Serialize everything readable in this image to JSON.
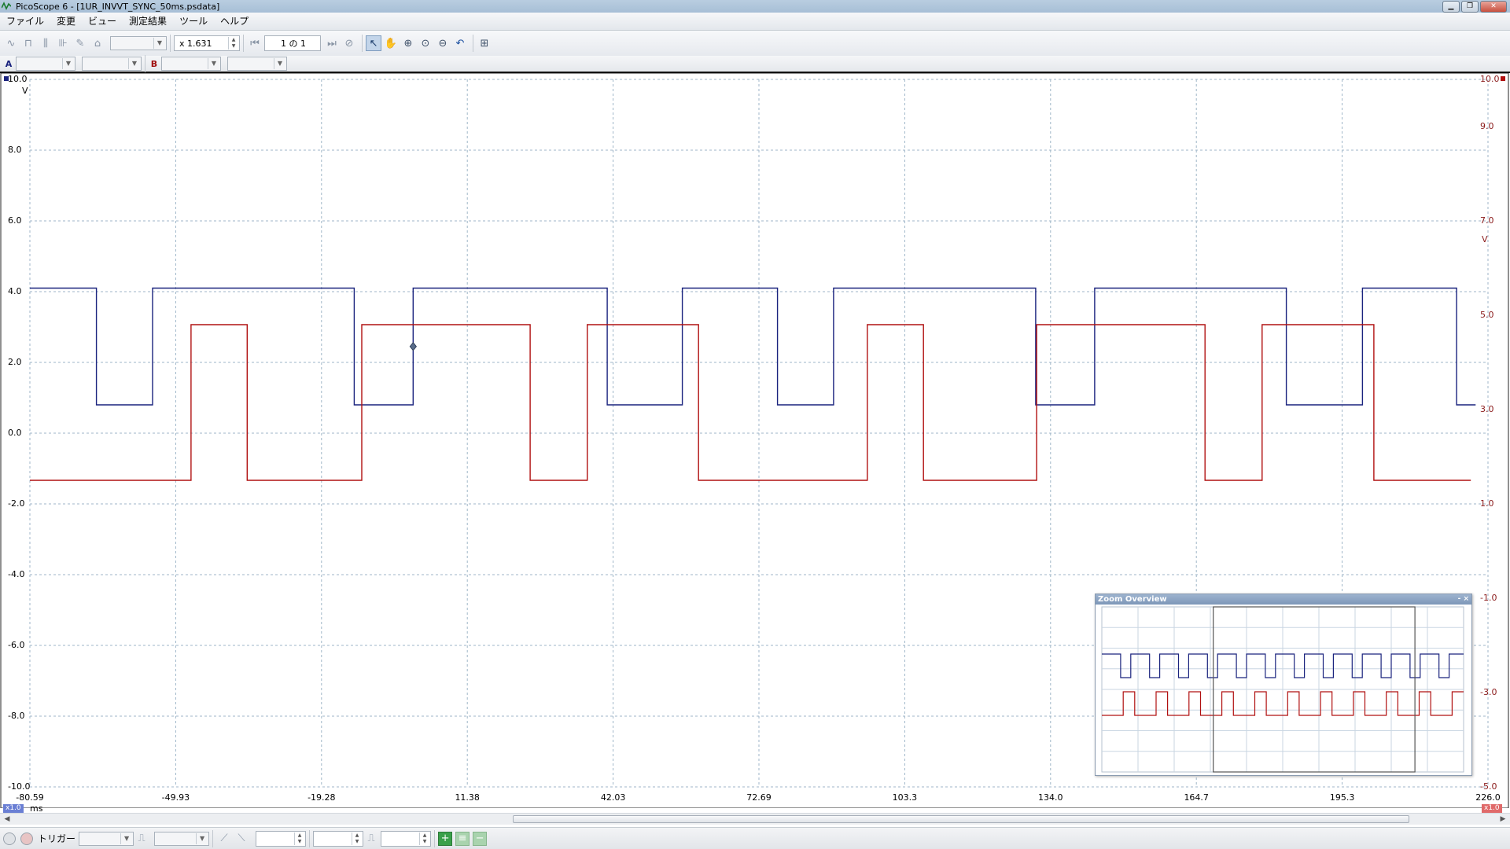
{
  "window": {
    "title": "PicoScope 6 - [1UR_INVVT_SYNC_50ms.psdata]"
  },
  "menu": [
    "ファイル",
    "変更",
    "ビュー",
    "測定結果",
    "ツール",
    "ヘルプ"
  ],
  "toolbar": {
    "zoom_value": "x 1.631",
    "page_value": "1 の 1"
  },
  "channels": {
    "a_label": "A",
    "b_label": "B"
  },
  "axes": {
    "left_ticks": [
      "10.0",
      "8.0",
      "6.0",
      "4.0",
      "2.0",
      "0.0",
      "-2.0",
      "-4.0",
      "-6.0",
      "-8.0",
      "-10.0"
    ],
    "left_unit": "V",
    "right_ticks": [
      "10.0",
      "9.0",
      "7.0",
      "5.0",
      "3.0",
      "1.0",
      "-1.0",
      "-3.0",
      "-5.0"
    ],
    "right_unit": "V",
    "x_ticks": [
      "-80.59",
      "-49.93",
      "-19.28",
      "11.38",
      "42.03",
      "72.69",
      "103.3",
      "134.0",
      "164.7",
      "195.3",
      "226.0"
    ],
    "x_unit": "ms",
    "left_scale_badge": "x1.0",
    "right_scale_badge": "x1.0"
  },
  "zoom_overview": {
    "title": "Zoom Overview",
    "controls": "- ×"
  },
  "statusbar": {
    "trigger_label": "トリガー"
  },
  "icons": [
    "channel-a-icon",
    "channel-b-icon",
    "pointer-icon",
    "hand-icon",
    "zoom-in-icon",
    "zoom-out-icon",
    "undo-zoom-icon"
  ],
  "chart_data": {
    "type": "line",
    "xlabel": "ms",
    "ylabel": "V",
    "xlim": [
      -80.59,
      226.0
    ],
    "ylim": [
      -10.0,
      10.0
    ],
    "right_ylim": [
      -5.0,
      10.0
    ],
    "grid": true,
    "series": [
      {
        "name": "A",
        "color": "#1a237e",
        "high": 4.1,
        "low": 0.8,
        "transitions_ms": [
          [
            -80.59,
            4.1
          ],
          [
            -66.6,
            4.1
          ],
          [
            -66.6,
            0.8
          ],
          [
            -54.8,
            0.8
          ],
          [
            -54.8,
            4.1
          ],
          [
            -12.4,
            4.1
          ],
          [
            -12.4,
            0.8
          ],
          [
            0.0,
            0.8
          ],
          [
            0.0,
            4.1
          ],
          [
            40.8,
            4.1
          ],
          [
            40.8,
            0.8
          ],
          [
            56.6,
            0.8
          ],
          [
            56.6,
            4.1
          ],
          [
            76.6,
            4.1
          ],
          [
            76.6,
            0.8
          ],
          [
            88.4,
            0.8
          ],
          [
            88.4,
            4.1
          ],
          [
            130.9,
            4.1
          ],
          [
            130.9,
            0.8
          ],
          [
            143.3,
            0.8
          ],
          [
            143.3,
            4.1
          ],
          [
            183.6,
            4.1
          ],
          [
            183.6,
            0.8
          ],
          [
            199.6,
            0.8
          ],
          [
            199.6,
            4.1
          ],
          [
            219.4,
            4.1
          ],
          [
            219.4,
            0.8
          ],
          [
            223.4,
            0.8
          ]
        ]
      },
      {
        "name": "B",
        "color": "#b01010",
        "high": 4.8,
        "low": 1.5,
        "transitions_ms": [
          [
            -80.59,
            1.5
          ],
          [
            -46.7,
            1.5
          ],
          [
            -46.7,
            4.8
          ],
          [
            -34.9,
            4.8
          ],
          [
            -34.9,
            1.5
          ],
          [
            -10.8,
            1.5
          ],
          [
            -10.8,
            4.8
          ],
          [
            24.6,
            4.8
          ],
          [
            24.6,
            1.5
          ],
          [
            36.6,
            1.5
          ],
          [
            36.6,
            4.8
          ],
          [
            60.0,
            4.8
          ],
          [
            60.0,
            1.5
          ],
          [
            95.5,
            1.5
          ],
          [
            95.5,
            4.8
          ],
          [
            107.3,
            4.8
          ],
          [
            107.3,
            1.5
          ],
          [
            131.1,
            1.5
          ],
          [
            131.1,
            4.8
          ],
          [
            166.5,
            4.8
          ],
          [
            166.5,
            1.5
          ],
          [
            178.5,
            1.5
          ],
          [
            178.5,
            4.8
          ],
          [
            202.0,
            4.8
          ],
          [
            202.0,
            1.5
          ],
          [
            222.4,
            1.5
          ]
        ]
      }
    ]
  }
}
